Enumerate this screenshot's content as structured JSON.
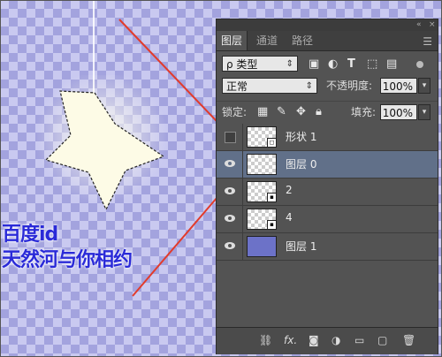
{
  "canvas": {
    "watermark_line1": "百度id",
    "watermark_line2": "天然河与你相约",
    "watermark_color": "#2a2ad8",
    "shape": "star"
  },
  "panel": {
    "titlebar": {
      "collapse_icon": "double-chevron-left-icon",
      "close_icon": "close-icon"
    },
    "tabs": [
      {
        "label": "图层",
        "active": true
      },
      {
        "label": "通道",
        "active": false
      },
      {
        "label": "路径",
        "active": false
      }
    ],
    "menu_icon": "panel-menu-icon",
    "filter": {
      "label": "ρ 类型",
      "icons": [
        "image-filter-icon",
        "adjustment-filter-icon",
        "type-filter-icon",
        "shape-filter-icon",
        "smart-object-filter-icon"
      ]
    },
    "blend": {
      "mode": "正常",
      "opacity_label": "不透明度:",
      "opacity": "100%"
    },
    "lock": {
      "label": "锁定:",
      "fill_label": "填充:",
      "fill": "100%",
      "icons": [
        "lock-transparent-icon",
        "lock-paint-icon",
        "lock-move-icon",
        "lock-all-icon"
      ]
    },
    "layers": [
      {
        "name": "形状 1",
        "visible": false,
        "selected": false,
        "thumb": "transparent",
        "badge": "shape"
      },
      {
        "name": "图层 0",
        "visible": true,
        "selected": true,
        "thumb": "transparent",
        "badge": ""
      },
      {
        "name": "2",
        "visible": true,
        "selected": false,
        "thumb": "transparent",
        "badge": "smart"
      },
      {
        "name": "4",
        "visible": true,
        "selected": false,
        "thumb": "transparent",
        "badge": "smart"
      },
      {
        "name": "图层 1",
        "visible": true,
        "selected": false,
        "thumb": "fill",
        "badge": ""
      }
    ],
    "footer_icons": [
      "link-icon",
      "fx-icon",
      "mask-icon",
      "adjustment-icon",
      "folder-icon",
      "new-layer-icon",
      "trash-icon"
    ],
    "footer_fx_label": "fx."
  },
  "colors": {
    "accent_selected_row": "#617089",
    "panel_bg": "#535353",
    "layer1_fill": "#6c72c8"
  }
}
